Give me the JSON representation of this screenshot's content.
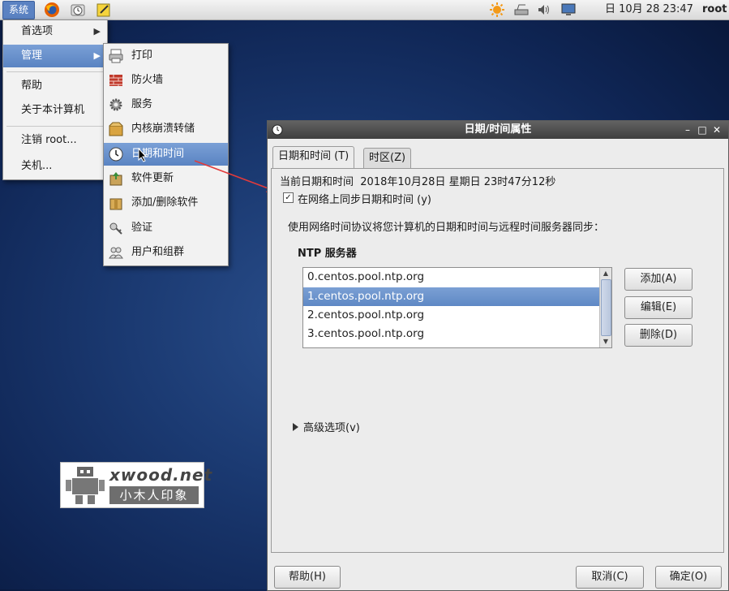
{
  "panel": {
    "system_menu": "系统",
    "clock": "日 10月 28 23:47",
    "user": "root"
  },
  "main_menu": {
    "items": [
      {
        "label": "首选项",
        "submenu": true
      },
      {
        "label": "管理",
        "submenu": true,
        "active": true
      },
      {
        "label": "帮助"
      },
      {
        "label": "关于本计算机"
      },
      {
        "label": "注销 root..."
      },
      {
        "label": "关机..."
      }
    ]
  },
  "admin_menu": {
    "items": [
      {
        "label": "打印",
        "icon": "printer-icon"
      },
      {
        "label": "防火墙",
        "icon": "firewall-icon"
      },
      {
        "label": "服务",
        "icon": "gear-icon"
      },
      {
        "label": "内核崩溃转储",
        "icon": "kernel-dump-icon"
      },
      {
        "label": "日期和时间",
        "icon": "clock-icon",
        "active": true
      },
      {
        "label": "软件更新",
        "icon": "software-update-icon"
      },
      {
        "label": "添加/删除软件",
        "icon": "package-icon"
      },
      {
        "label": "验证",
        "icon": "keys-icon"
      },
      {
        "label": "用户和组群",
        "icon": "users-icon"
      }
    ]
  },
  "dialog": {
    "title": "日期/时间属性",
    "tabs": [
      {
        "label": "日期和时间 (T)",
        "active": true
      },
      {
        "label": "时区(Z)"
      }
    ],
    "current_label": "当前日期和时间",
    "current_value": "2018年10月28日  星期日  23时47分12秒",
    "sync_checkbox": {
      "label": "在网络上同步日期和时间 (y)",
      "checked": true
    },
    "description": "使用网络时间协议将您计算机的日期和时间与远程时间服务器同步：",
    "ntp_heading": "NTP 服务器",
    "ntp_servers": [
      "0.centos.pool.ntp.org",
      "1.centos.pool.ntp.org",
      "2.centos.pool.ntp.org",
      "3.centos.pool.ntp.org"
    ],
    "selected_server_index": 1,
    "buttons": {
      "add": "添加(A)",
      "edit": "编辑(E)",
      "delete": "删除(D)",
      "help": "帮助(H)",
      "cancel": "取消(C)",
      "ok": "确定(O)"
    },
    "advanced": "高级选项(v)"
  },
  "watermark": {
    "brand": "xwood.net",
    "tagline": "小木人印象"
  },
  "colors": {
    "highlight": "#5a84c2",
    "titlebar": "#4a4a4a",
    "desktop": "#1b3a72",
    "annotation_arrow": "#e23b3b"
  }
}
